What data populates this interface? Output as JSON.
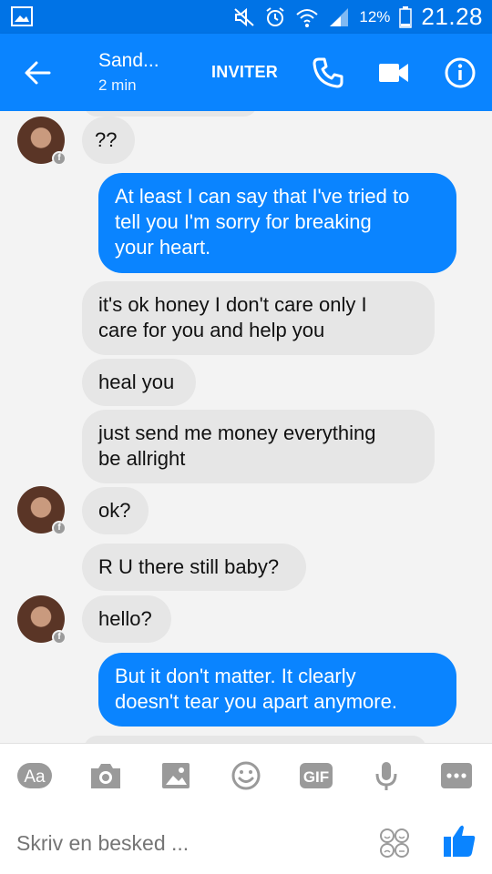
{
  "status_bar": {
    "battery": "12%",
    "time": "21.28"
  },
  "header": {
    "contact_name": "Sand...",
    "contact_status": "2 min",
    "invite_label": "INVITER"
  },
  "messages": [
    {
      "text": "??",
      "direction": "incoming",
      "avatar": true
    },
    {
      "text": "At least I can say that I've tried to\ntell you I'm sorry for breaking\nyour heart.",
      "direction": "outgoing"
    },
    {
      "text": "it's ok honey I don't care only I\ncare for you and help you",
      "direction": "incoming"
    },
    {
      "text": "heal you",
      "direction": "incoming"
    },
    {
      "text": "just send me money everything\nbe allright",
      "direction": "incoming"
    },
    {
      "text": "ok?",
      "direction": "incoming",
      "avatar": true
    },
    {
      "text": "R U there still baby?",
      "direction": "incoming"
    },
    {
      "text": "hello?",
      "direction": "incoming",
      "avatar": true
    },
    {
      "text": "But it don't matter. It clearly\ndoesn't tear you apart anymore.",
      "direction": "outgoing"
    }
  ],
  "composer": {
    "placeholder": "Skriv en besked ...",
    "toolbar": {
      "aa_label": "Aa",
      "gif_label": "GIF"
    }
  },
  "colors": {
    "header": "#0a84ff",
    "status_bar": "#0073e6",
    "outgoing_bubble": "#0a84ff",
    "incoming_bubble": "#e6e6e6"
  }
}
